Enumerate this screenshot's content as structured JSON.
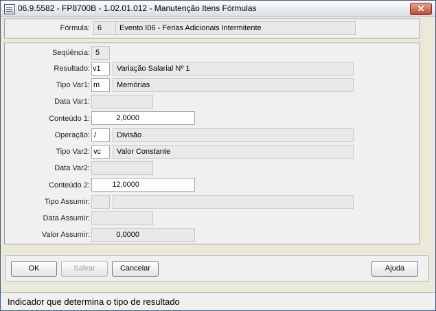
{
  "window": {
    "title": "06.9.5582 - FP8700B - 1.02.01.012 - Manutenção Itens Fórmulas",
    "close_symbol": "✕"
  },
  "formula": {
    "label": "Fórmula:",
    "code": "6",
    "name": "Evento I06 - Ferias Adicionais Intermitente"
  },
  "form": {
    "sequencia": {
      "label": "Seqüência:",
      "value": "5"
    },
    "resultado": {
      "label": "Resultado:",
      "code": "v1",
      "desc": "Variação Salarial Nº 1"
    },
    "tipo_var1": {
      "label": "Tipo Var1:",
      "code": "m",
      "desc": "Memórias"
    },
    "data_var1": {
      "label": "Data Var1:",
      "value": ""
    },
    "conteudo1": {
      "label": "Conteúdo 1:",
      "value": "2,0000"
    },
    "operacao": {
      "label": "Operação:",
      "code": "/",
      "desc": "Divisão"
    },
    "tipo_var2": {
      "label": "Tipo Var2:",
      "code": "vc",
      "desc": "Valor Constante"
    },
    "data_var2": {
      "label": "Data Var2:",
      "value": ""
    },
    "conteudo2": {
      "label": "Conteúdo 2:",
      "value": "12,0000"
    },
    "tipo_assumir": {
      "label": "Tipo Assumir:",
      "code": "",
      "desc": ""
    },
    "data_assumir": {
      "label": "Data Assumir:",
      "value": ""
    },
    "valor_assumir": {
      "label": "Valor Assumir:",
      "value": "0,0000"
    }
  },
  "buttons": {
    "ok": "OK",
    "salvar": "Salvar",
    "cancelar": "Cancelar",
    "ajuda": "Ajuda"
  },
  "status": {
    "text": "Indicador que determina o tipo de resultado"
  }
}
